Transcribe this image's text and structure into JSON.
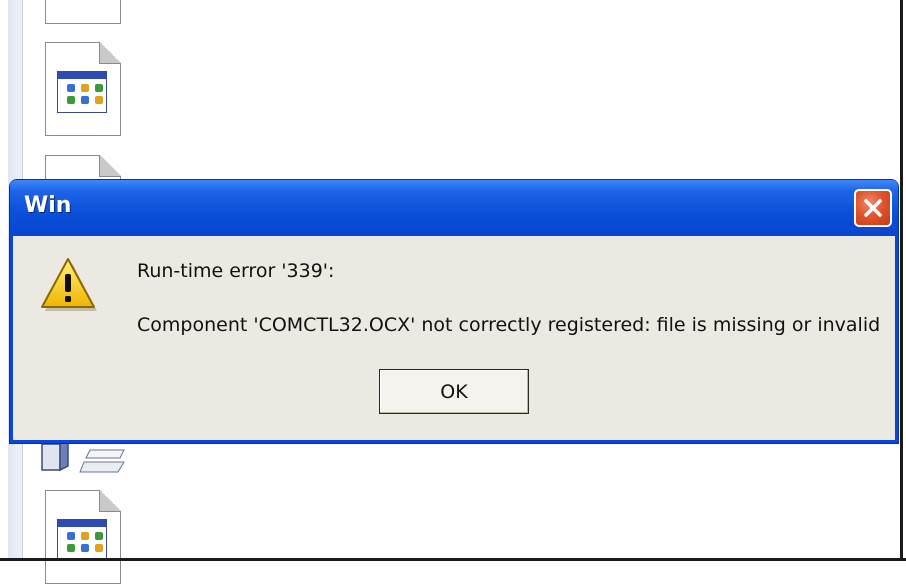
{
  "dialog": {
    "title": "Win",
    "error_heading": "Run-time error '339':",
    "error_message": "Component 'COMCTL32.OCX' not correctly registered: file is missing or invalid",
    "ok_label": "OK",
    "icon": "warning-icon",
    "close_icon": "close-icon"
  },
  "background": {
    "icons": [
      "file-icon",
      "application-file-icon",
      "file-icon",
      "cube-icon",
      "application-file-icon"
    ]
  },
  "colors": {
    "titlebar": "#0a4fd8",
    "dialog_body": "#ebe9e1",
    "close_button": "#e0552f",
    "warning_yellow": "#f5c400"
  }
}
